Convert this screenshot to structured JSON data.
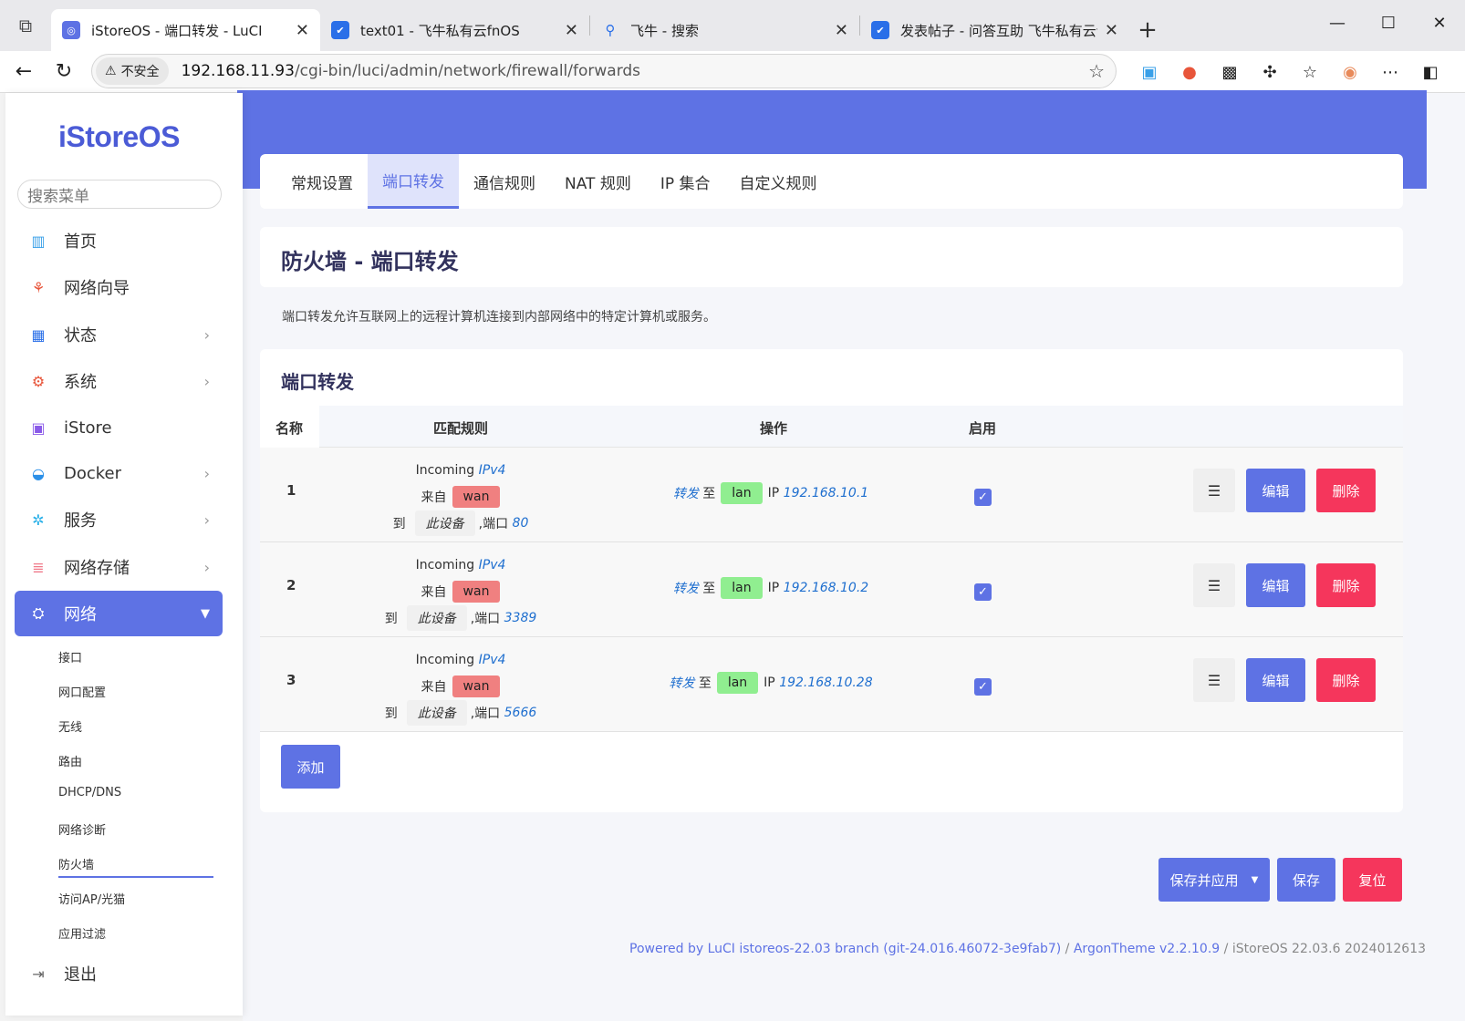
{
  "browser": {
    "tabs": [
      {
        "title": "iStoreOS - 端口转发 - LuCI",
        "active": true
      },
      {
        "title": "text01 - 飞牛私有云fnOS",
        "active": false
      },
      {
        "title": "飞牛 - 搜索",
        "active": false
      },
      {
        "title": "发表帖子 - 问答互助 飞牛私有云论",
        "active": false
      }
    ],
    "insecure_label": "不安全",
    "url_host": "192.168.11.93",
    "url_path": "/cgi-bin/luci/admin/network/firewall/forwards"
  },
  "sidebar": {
    "logo": "iStoreOS",
    "search_placeholder": "搜索菜单",
    "items": [
      {
        "label": "首页",
        "icon": "chart-icon"
      },
      {
        "label": "网络向导",
        "icon": "wizard-icon"
      },
      {
        "label": "状态",
        "icon": "grid-icon"
      },
      {
        "label": "系统",
        "icon": "gear-icon"
      },
      {
        "label": "iStore",
        "icon": "store-icon"
      },
      {
        "label": "Docker",
        "icon": "docker-icon"
      },
      {
        "label": "服务",
        "icon": "services-icon"
      },
      {
        "label": "网络存储",
        "icon": "storage-icon"
      },
      {
        "label": "网络",
        "icon": "network-icon"
      }
    ],
    "sub_items": [
      "接口",
      "网口配置",
      "无线",
      "路由",
      "DHCP/DNS",
      "网络诊断",
      "防火墙",
      "访问AP/光猫",
      "应用过滤"
    ],
    "logout": "退出"
  },
  "tabs": [
    "常规设置",
    "端口转发",
    "通信规则",
    "NAT 规则",
    "IP 集合",
    "自定义规则"
  ],
  "page": {
    "title": "防火墙 - 端口转发",
    "description": "端口转发允许互联网上的远程计算机连接到内部网络中的特定计算机或服务。"
  },
  "table": {
    "section_title": "端口转发",
    "headers": {
      "name": "名称",
      "match": "匹配规则",
      "action": "操作",
      "enable": "启用"
    },
    "rows": [
      {
        "name": "1",
        "incoming": "Incoming",
        "family": "IPv4",
        "from_label": "来自",
        "from_zone": "wan",
        "to_label": "到",
        "to_dev": "此设备",
        "port_label": ",端口",
        "port": "80",
        "fwd": "转发",
        "to2": "至",
        "zone": "lan",
        "ip_label": "IP",
        "ip": "192.168.10.1"
      },
      {
        "name": "2",
        "incoming": "Incoming",
        "family": "IPv4",
        "from_label": "来自",
        "from_zone": "wan",
        "to_label": "到",
        "to_dev": "此设备",
        "port_label": ",端口",
        "port": "3389",
        "fwd": "转发",
        "to2": "至",
        "zone": "lan",
        "ip_label": "IP",
        "ip": "192.168.10.2"
      },
      {
        "name": "3",
        "incoming": "Incoming",
        "family": "IPv4",
        "from_label": "来自",
        "from_zone": "wan",
        "to_label": "到",
        "to_dev": "此设备",
        "port_label": ",端口",
        "port": "5666",
        "fwd": "转发",
        "to2": "至",
        "zone": "lan",
        "ip_label": "IP",
        "ip": "192.168.10.28"
      }
    ],
    "btn_menu": "☰",
    "btn_edit": "编辑",
    "btn_delete": "删除",
    "btn_add": "添加"
  },
  "actions": {
    "save_apply": "保存并应用",
    "save": "保存",
    "reset": "复位"
  },
  "footer": {
    "luci": "Powered by LuCI istoreos-22.03 branch (git-24.016.46072-3e9fab7)",
    "sep1": " / ",
    "theme": "ArgonTheme v2.2.10.9",
    "sep2": " / ",
    "os": "iStoreOS 22.03.6 2024012613"
  },
  "colors": {
    "accent": "#5e72e4",
    "danger": "#f5365c",
    "wan": "#f08080",
    "lan": "#90ee90"
  }
}
